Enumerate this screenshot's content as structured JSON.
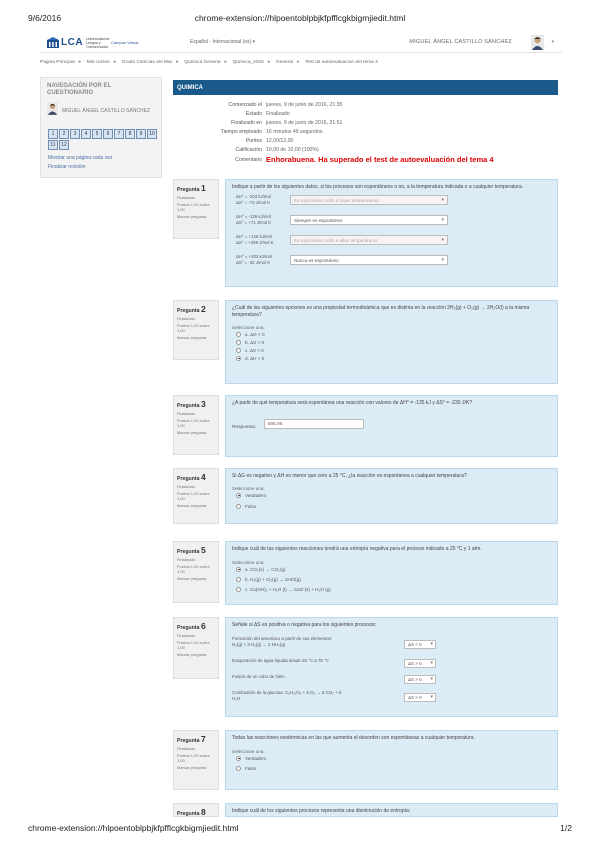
{
  "print": {
    "date": "9/6/2016",
    "title": "chrome-extension://hlpoentoblpbjkfpfflcgkbigmjiedit.html",
    "footer_url": "chrome-extension://hlpoentoblpbjkfpfflcgkbigmjiedit.html",
    "page": "1/2"
  },
  "navbar": {
    "logo": "LCA",
    "logo_sub": "Universidad de Lengua y Comunicación",
    "logo_campus": "Campus Virtual",
    "language": "Español - Internacional (es) ▾",
    "user_name": "MIGUEL ÁNGEL CASTILLO SÁNCHEZ"
  },
  "breadcrumb": [
    "Página Principal",
    "Mis cursos",
    "Grado Ciencias del Mar",
    "Química General",
    "Química_2016",
    "General",
    "Test de autoevaluación del tema 4"
  ],
  "sidebar": {
    "title": "NAVEGACIÓN POR EL CUESTIONARIO",
    "user": "MIGUEL ÁNGEL CASTILLO SÁNCHEZ",
    "questions": [
      "1",
      "2",
      "3",
      "4",
      "5",
      "6",
      "7",
      "8",
      "9",
      "10",
      "11",
      "12"
    ],
    "link_page": "Mostrar una página cada vez",
    "link_finish": "Finalizar revisión"
  },
  "summary": {
    "header": "QUIMICA",
    "rows": [
      {
        "label": "Comenzado el",
        "value": "jueves, 9 de junio de 2016, 21:35"
      },
      {
        "label": "Estado",
        "value": "Finalizado"
      },
      {
        "label": "Finalizado en",
        "value": "jueves, 9 de junio de 2016, 21:51"
      },
      {
        "label": "Tiempo empleado",
        "value": "16 minutos 49 segundos"
      },
      {
        "label": "Puntos",
        "value": "12,00/12,00"
      },
      {
        "label": "Calificación",
        "value": "10,00 de 10,00 (100%)"
      },
      {
        "label": "Comentario",
        "value": "Enhorabuena. Ha superado el test de autoevaluación del tema 4"
      }
    ]
  },
  "questions": [
    {
      "number": "1",
      "label": "Pregunta",
      "state": "Finalizado",
      "grade": "Puntúa 1,00 sobre 1,00",
      "flag": "Marcar pregunta",
      "text": "Indique a partir de los siguientes datos, si los procesos son espontáneos o no, a la temperatura indicada o a cualquier temperatura.",
      "matches": [
        {
          "line1": "ΔH° = -203 kJ/mol",
          "line2": "ΔS° = -73 J/mol K",
          "answer": "Es espontáneo sólo a bajas temperaturas",
          "disabled": true
        },
        {
          "line1": "ΔH° = -126 kJ/mol",
          "line2": "ΔS° = +71 J/mol K",
          "answer": "Siempre es espontáneo",
          "disabled": false
        },
        {
          "line1": "ΔH° = +126 kJ/mol",
          "line2": "ΔS° = +259 J/mol K",
          "answer": "Es espontáneo sólo a altas temperaturas",
          "disabled": true
        },
        {
          "line1": "ΔH° = +203 kJ/mol",
          "line2": "ΔS° = -32 J/mol K",
          "answer": "Nunca es espontáneo",
          "disabled": false
        }
      ]
    },
    {
      "number": "2",
      "label": "Pregunta",
      "state": "Finalizado",
      "grade": "Puntúa 1,00 sobre 1,00",
      "flag": "Marcar pregunta",
      "text": "¿Cuál de las siguientes opciones es una propiedad termodinámica que es distinta en la reacción 2H₂(g) + O₂(g) → 2H₂O(l) a la misma temperatura?",
      "prompt": "Seleccione una:",
      "options": [
        {
          "label": "a. ΔG < 0",
          "selected": false
        },
        {
          "label": "b. ΔS > 0",
          "selected": false
        },
        {
          "label": "c. ΔS < 0",
          "selected": false
        },
        {
          "label": "d. ΔH < 0",
          "selected": true
        }
      ]
    },
    {
      "number": "3",
      "label": "Pregunta",
      "state": "Finalizado",
      "grade": "Puntúa 1,00 sobre 1,00",
      "flag": "Marcar pregunta",
      "text": "¿A partir de qué temperatura será espontánea una reacción con valores de ΔH° = -135 kJ y ΔS° = -230 J/K?",
      "answer_label": "Respuesta:",
      "answer": "586,95"
    },
    {
      "number": "4",
      "label": "Pregunta",
      "state": "Finalizado",
      "grade": "Puntúa 1,00 sobre 1,00",
      "flag": "Marcar pregunta",
      "text": "Si ΔG es negativo y ΔH es menor que cero a 25 °C, ¿la reacción es espontánea a cualquier temperatura?",
      "prompt": "Seleccione una:",
      "options": [
        {
          "label": "Verdadero",
          "selected": true
        },
        {
          "label": "Falso",
          "selected": false
        }
      ]
    },
    {
      "number": "5",
      "label": "Pregunta",
      "state": "Finalizado",
      "grade": "Puntúa 1,00 sobre 1,00",
      "flag": "Marcar pregunta",
      "text": "Indique cuál de las siguientes reacciones tendrá una entropía negativa para el proceso indicado a 25 °C y 1 atm.",
      "prompt": "Seleccione una:",
      "options": [
        {
          "label": "a. CO₂(s) → CO₂(g)",
          "selected": true
        },
        {
          "label": "b. H₂(g) + Cl₂(g) → 2HCl(g)",
          "selected": false
        },
        {
          "label": "c. Ca(OH)₂ + H₂O (l) → CaO (s) + H₂O (g)",
          "selected": false
        }
      ]
    },
    {
      "number": "6",
      "label": "Pregunta",
      "state": "Finalizado",
      "grade": "Puntúa 1,00 sobre 1,00",
      "flag": "Marcar pregunta",
      "text": "Señale si ΔS es positiva o negativa para los siguientes procesos:",
      "rows": [
        {
          "label": "Formación del amoníaco a partir de sus elementos: N₂(g) + 3 H₂(g) → 2 NH₃(g)",
          "answer": "ΔS < 0"
        },
        {
          "label": "Evaporación de agua líquida desde 25 °C a 75 °C",
          "answer": "ΔS > 0"
        },
        {
          "label": "Fusión de un cubo de hielo",
          "answer": "ΔS > 0"
        },
        {
          "label": "Combustión de la glucosa: C₆H₁₂O₆ + 6 O₂ → 6 CO₂ + 6 H₂O",
          "answer": "ΔS > 0"
        }
      ]
    },
    {
      "number": "7",
      "label": "Pregunta",
      "state": "Finalizado",
      "grade": "Puntúa 1,00 sobre 1,00",
      "flag": "Marcar pregunta",
      "text": "Todas las reacciones exotérmicas en las que aumenta el desorden son espontáneas a cualquier temperatura.",
      "prompt": "Seleccione una:",
      "options": [
        {
          "label": "Verdadero",
          "selected": true
        },
        {
          "label": "Falso",
          "selected": false
        }
      ]
    },
    {
      "number": "8",
      "label": "Pregunta",
      "text": "Indique cuál de los siguientes procesos representa una disminución de entropía:"
    }
  ]
}
